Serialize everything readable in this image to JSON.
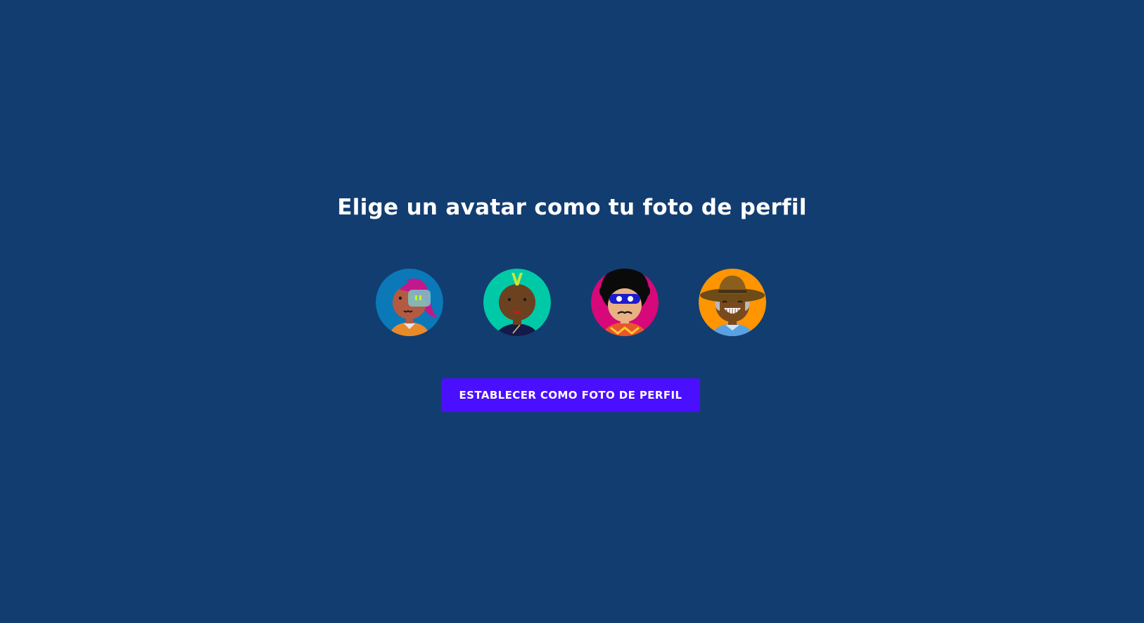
{
  "page": {
    "title": "Elige un avatar como tu foto de perfil"
  },
  "avatars": [
    {
      "label": "avatar-1",
      "background": "#0b78b8",
      "icon": "woman-pink-hair-visor-icon"
    },
    {
      "label": "avatar-2",
      "background": "#00c9a7",
      "icon": "person-mohawk-icon"
    },
    {
      "label": "avatar-3",
      "background": "#d6087a",
      "icon": "person-afro-mask-icon"
    },
    {
      "label": "avatar-4",
      "background": "#ff9500",
      "icon": "man-hat-smile-icon"
    }
  ],
  "actions": {
    "set_profile_photo_label": "ESTABLECER COMO FOTO DE PERFIL"
  },
  "colors": {
    "background": "#123d70",
    "button": "#4b0fff",
    "text": "#ffffff"
  }
}
